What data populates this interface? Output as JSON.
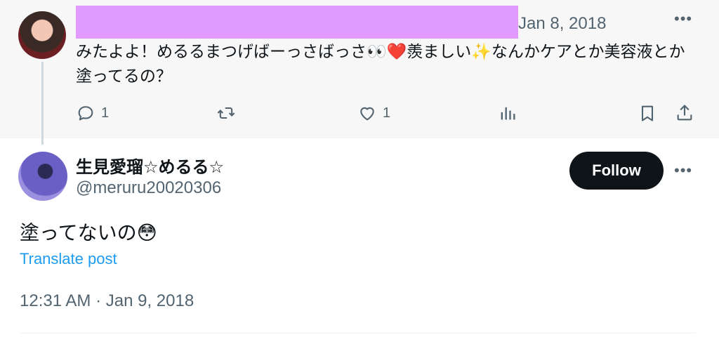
{
  "parent_tweet": {
    "date": "Jan 8, 2018",
    "more": "•••",
    "text": "みたよよ！めるるまつげばーっさばっさ👀❤️羨ましい✨なんかケアとか美容液とか塗ってるの？",
    "actions": {
      "reply_count": "1",
      "like_count": "1"
    }
  },
  "reply_tweet": {
    "name": "生見愛瑠☆めるる☆",
    "handle": "@meruru20020306",
    "follow_label": "Follow",
    "more": "•••",
    "text": "塗ってないの😳",
    "translate_label": "Translate post",
    "timestamp": "12:31 AM · Jan 9, 2018"
  },
  "colors": {
    "accent": "#1d9bf0",
    "follow_bg": "#0f1419",
    "redaction": "#e19bff",
    "secondary_text": "#536471"
  },
  "icons": [
    "reply-icon",
    "retweet-icon",
    "like-icon",
    "views-icon",
    "bookmark-icon",
    "share-icon",
    "more-icon"
  ]
}
